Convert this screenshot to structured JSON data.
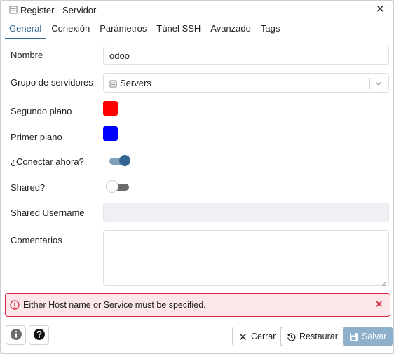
{
  "dialog": {
    "title": "Register - Servidor",
    "close_icon": "close-icon"
  },
  "tabs": [
    {
      "label": "General",
      "active": true
    },
    {
      "label": "Conexión",
      "active": false
    },
    {
      "label": "Parámetros",
      "active": false
    },
    {
      "label": "Túnel SSH",
      "active": false
    },
    {
      "label": "Avanzado",
      "active": false
    },
    {
      "label": "Tags",
      "active": false
    }
  ],
  "form": {
    "name": {
      "label": "Nombre",
      "value": "odoo"
    },
    "server_group": {
      "label": "Grupo de servidores",
      "value": "Servers"
    },
    "background": {
      "label": "Segundo plano",
      "color": "#ff0000"
    },
    "foreground": {
      "label": "Primer plano",
      "color": "#0000ff"
    },
    "connect_now": {
      "label": "¿Conectar ahora?",
      "on": true
    },
    "shared": {
      "label": "Shared?",
      "on": false
    },
    "shared_username": {
      "label": "Shared Username",
      "value": ""
    },
    "comments": {
      "label": "Comentarios",
      "value": ""
    }
  },
  "error": {
    "message": "Either Host name or Service must be specified.",
    "color": "#d7263d"
  },
  "footer": {
    "close_label": "Cerrar",
    "reset_label": "Restaurar",
    "save_label": "Salvar"
  },
  "colors": {
    "accent": "#326690",
    "save_disabled": "#8fb0cb"
  }
}
